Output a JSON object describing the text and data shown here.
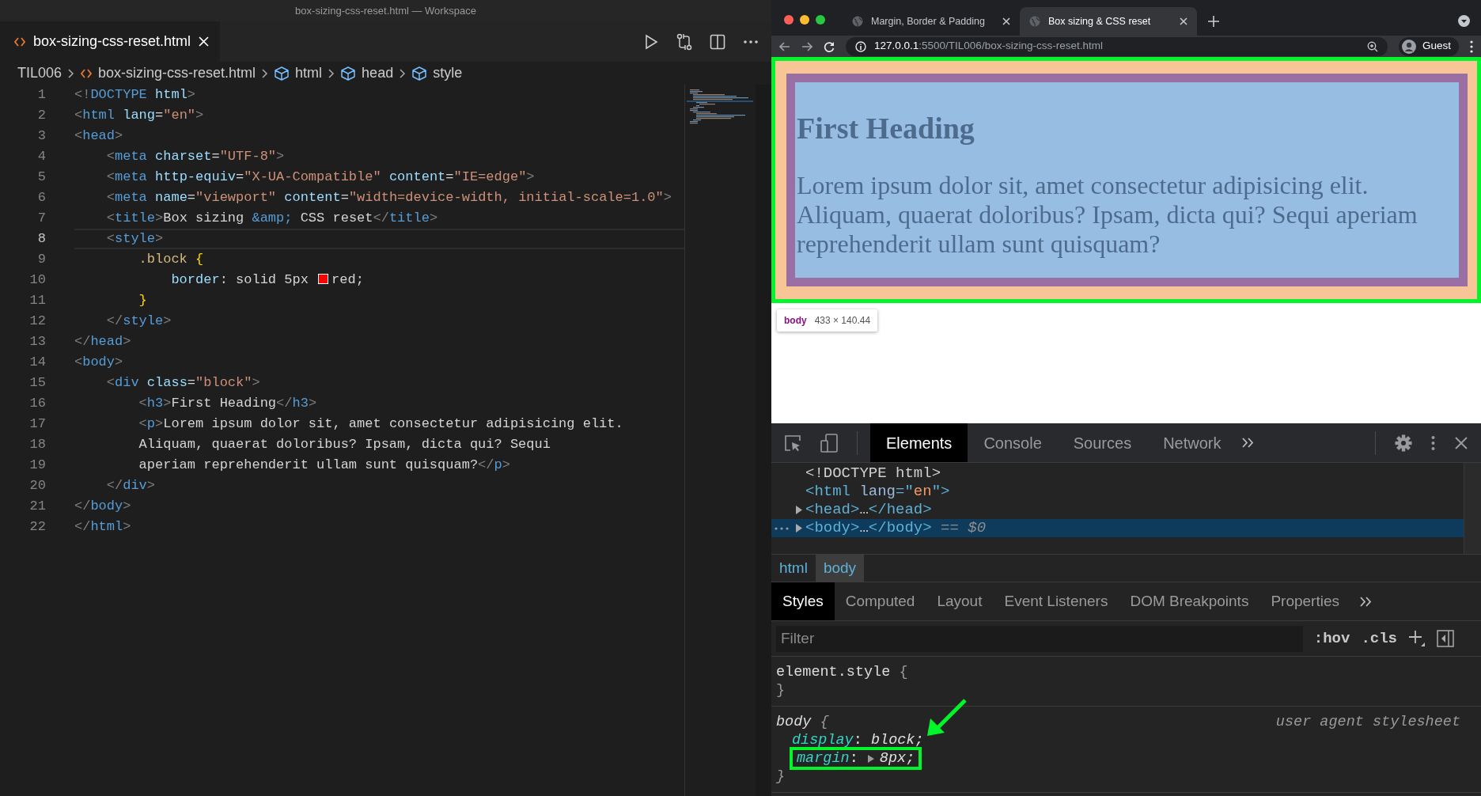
{
  "editor": {
    "window_title": "box-sizing-css-reset.html — Workspace",
    "tab": {
      "label": "box-sizing-css-reset.html"
    },
    "breadcrumbs": [
      {
        "kind": "folder",
        "label": "TIL006"
      },
      {
        "kind": "file",
        "label": "box-sizing-css-reset.html"
      },
      {
        "kind": "element",
        "label": "html"
      },
      {
        "kind": "element",
        "label": "head"
      },
      {
        "kind": "element",
        "label": "style"
      }
    ],
    "lines": [
      {
        "number": "1",
        "selected": false,
        "tokens": [
          {
            "kind": "p",
            "text": "<!"
          },
          {
            "kind": "tag",
            "text": "DOCTYPE"
          },
          {
            "kind": "attr",
            "text": " html"
          },
          {
            "kind": "p",
            "text": ">"
          }
        ]
      },
      {
        "number": "2",
        "selected": false,
        "tokens": [
          {
            "kind": "p",
            "text": "<"
          },
          {
            "kind": "tag",
            "text": "html"
          },
          {
            "kind": "attr",
            "text": " lang"
          },
          {
            "kind": "txt",
            "text": "="
          },
          {
            "kind": "str",
            "text": "\"en\""
          },
          {
            "kind": "p",
            "text": ">"
          }
        ]
      },
      {
        "number": "3",
        "selected": false,
        "tokens": [
          {
            "kind": "p",
            "text": "<"
          },
          {
            "kind": "tag",
            "text": "head"
          },
          {
            "kind": "p",
            "text": ">"
          }
        ]
      },
      {
        "number": "4",
        "selected": false,
        "tokens": [
          {
            "kind": "p",
            "text": "    <"
          },
          {
            "kind": "tag",
            "text": "meta"
          },
          {
            "kind": "attr",
            "text": " charset"
          },
          {
            "kind": "txt",
            "text": "="
          },
          {
            "kind": "str",
            "text": "\"UTF-8\""
          },
          {
            "kind": "p",
            "text": ">"
          }
        ]
      },
      {
        "number": "5",
        "selected": false,
        "tokens": [
          {
            "kind": "p",
            "text": "    <"
          },
          {
            "kind": "tag",
            "text": "meta"
          },
          {
            "kind": "attr",
            "text": " http-equiv"
          },
          {
            "kind": "txt",
            "text": "="
          },
          {
            "kind": "str",
            "text": "\"X-UA-Compatible\""
          },
          {
            "kind": "attr",
            "text": " content"
          },
          {
            "kind": "txt",
            "text": "="
          },
          {
            "kind": "str",
            "text": "\"IE=edge\""
          },
          {
            "kind": "p",
            "text": ">"
          }
        ]
      },
      {
        "number": "6",
        "selected": false,
        "tokens": [
          {
            "kind": "p",
            "text": "    <"
          },
          {
            "kind": "tag",
            "text": "meta"
          },
          {
            "kind": "attr",
            "text": " name"
          },
          {
            "kind": "txt",
            "text": "="
          },
          {
            "kind": "str",
            "text": "\"viewport\""
          },
          {
            "kind": "attr",
            "text": " content"
          },
          {
            "kind": "txt",
            "text": "="
          },
          {
            "kind": "str",
            "text": "\"width=device-width, initial-scale=1.0\""
          },
          {
            "kind": "p",
            "text": ">"
          }
        ]
      },
      {
        "number": "7",
        "selected": false,
        "tokens": [
          {
            "kind": "p",
            "text": "    <"
          },
          {
            "kind": "tag",
            "text": "title"
          },
          {
            "kind": "p",
            "text": ">"
          },
          {
            "kind": "txt",
            "text": "Box sizing "
          },
          {
            "kind": "ent",
            "text": "&amp;"
          },
          {
            "kind": "txt",
            "text": " CSS reset"
          },
          {
            "kind": "p",
            "text": "</"
          },
          {
            "kind": "tag",
            "text": "title"
          },
          {
            "kind": "p",
            "text": ">"
          }
        ]
      },
      {
        "number": "8",
        "selected": true,
        "tokens": [
          {
            "kind": "p",
            "text": "    <"
          },
          {
            "kind": "tag",
            "text": "style"
          },
          {
            "kind": "p",
            "text": ">"
          }
        ]
      },
      {
        "number": "9",
        "selected": false,
        "tokens": [
          {
            "kind": "sel",
            "text": "        .block"
          },
          {
            "kind": "brace",
            "text": " {"
          }
        ]
      },
      {
        "number": "10",
        "selected": false,
        "tokens": [
          {
            "kind": "prop",
            "text": "            border"
          },
          {
            "kind": "txt",
            "text": ": solid 5px "
          },
          {
            "kind": "swatch",
            "color": "#ff0000"
          },
          {
            "kind": "txt",
            "text": "red;"
          }
        ]
      },
      {
        "number": "11",
        "selected": false,
        "tokens": [
          {
            "kind": "brace",
            "text": "        }"
          }
        ]
      },
      {
        "number": "12",
        "selected": false,
        "tokens": [
          {
            "kind": "p",
            "text": "    </"
          },
          {
            "kind": "tag",
            "text": "style"
          },
          {
            "kind": "p",
            "text": ">"
          }
        ]
      },
      {
        "number": "13",
        "selected": false,
        "tokens": [
          {
            "kind": "p",
            "text": "</"
          },
          {
            "kind": "tag",
            "text": "head"
          },
          {
            "kind": "p",
            "text": ">"
          }
        ]
      },
      {
        "number": "14",
        "selected": false,
        "tokens": [
          {
            "kind": "p",
            "text": "<"
          },
          {
            "kind": "tag",
            "text": "body"
          },
          {
            "kind": "p",
            "text": ">"
          }
        ]
      },
      {
        "number": "15",
        "selected": false,
        "tokens": [
          {
            "kind": "p",
            "text": "    <"
          },
          {
            "kind": "tag",
            "text": "div"
          },
          {
            "kind": "attr",
            "text": " class"
          },
          {
            "kind": "txt",
            "text": "="
          },
          {
            "kind": "str",
            "text": "\"block\""
          },
          {
            "kind": "p",
            "text": ">"
          }
        ]
      },
      {
        "number": "16",
        "selected": false,
        "tokens": [
          {
            "kind": "p",
            "text": "        <"
          },
          {
            "kind": "tag",
            "text": "h3"
          },
          {
            "kind": "p",
            "text": ">"
          },
          {
            "kind": "txt",
            "text": "First Heading"
          },
          {
            "kind": "p",
            "text": "</"
          },
          {
            "kind": "tag",
            "text": "h3"
          },
          {
            "kind": "p",
            "text": ">"
          }
        ]
      },
      {
        "number": "17",
        "selected": false,
        "tokens": [
          {
            "kind": "p",
            "text": "        <"
          },
          {
            "kind": "tag",
            "text": "p"
          },
          {
            "kind": "p",
            "text": ">"
          },
          {
            "kind": "txt",
            "text": "Lorem ipsum dolor sit, amet consectetur adipisicing elit."
          }
        ]
      },
      {
        "number": "18",
        "selected": false,
        "tokens": [
          {
            "kind": "txt",
            "text": "        Aliquam, quaerat doloribus? Ipsam, dicta qui? Sequi"
          }
        ]
      },
      {
        "number": "19",
        "selected": false,
        "tokens": [
          {
            "kind": "txt",
            "text": "        aperiam reprehenderit ullam sunt quisquam?"
          },
          {
            "kind": "p",
            "text": "</"
          },
          {
            "kind": "tag",
            "text": "p"
          },
          {
            "kind": "p",
            "text": ">"
          }
        ]
      },
      {
        "number": "20",
        "selected": false,
        "tokens": [
          {
            "kind": "p",
            "text": "    </"
          },
          {
            "kind": "tag",
            "text": "div"
          },
          {
            "kind": "p",
            "text": ">"
          }
        ]
      },
      {
        "number": "21",
        "selected": false,
        "tokens": [
          {
            "kind": "p",
            "text": "</"
          },
          {
            "kind": "tag",
            "text": "body"
          },
          {
            "kind": "p",
            "text": ">"
          }
        ]
      },
      {
        "number": "22",
        "selected": false,
        "tokens": [
          {
            "kind": "p",
            "text": "</"
          },
          {
            "kind": "tag",
            "text": "html"
          },
          {
            "kind": "p",
            "text": ">"
          }
        ]
      }
    ]
  },
  "browser": {
    "tabs": [
      {
        "label": "Margin, Border & Padding",
        "selected": false
      },
      {
        "label": "Box sizing & CSS reset",
        "selected": true
      }
    ],
    "url": {
      "host": "127.0.0.1",
      "rest": ":5500/TIL006/box-sizing-css-reset.html"
    },
    "profile": "Guest",
    "page": {
      "framed": true,
      "heading": "First Heading",
      "paragraph": "Lorem ipsum dolor sit, amet consectetur adipisicing elit. Aliquam, quaerat doloribus? Ipsam, dicta qui? Sequi aperiam reprehenderit ullam sunt quisquam?",
      "tooltip": {
        "tag": "body",
        "size": "433 × 140.44"
      }
    },
    "devtools": {
      "tabs": [
        {
          "label": "Elements",
          "selected": true
        },
        {
          "label": "Console",
          "selected": false
        },
        {
          "label": "Sources",
          "selected": false
        },
        {
          "label": "Network",
          "selected": false
        }
      ],
      "dom": [
        {
          "selected": false,
          "tokens": [
            {
              "kind": "plain",
              "text": "<!DOCTYPE html>"
            }
          ]
        },
        {
          "selected": false,
          "tokens": [
            {
              "kind": "tag",
              "text": "<html"
            },
            {
              "kind": "attr",
              "text": " lang"
            },
            {
              "kind": "tag",
              "text": "=\""
            },
            {
              "kind": "str",
              "text": "en"
            },
            {
              "kind": "tag",
              "text": "\">"
            }
          ]
        },
        {
          "expanded": false,
          "selected": false,
          "tokens": [
            {
              "kind": "tag",
              "text": "<head>"
            },
            {
              "kind": "plain",
              "text": "…"
            },
            {
              "kind": "tag",
              "text": "</head>"
            }
          ]
        },
        {
          "expanded": false,
          "selected": true,
          "tokens": [
            {
              "kind": "tag",
              "text": "<body>"
            },
            {
              "kind": "plain",
              "text": "…"
            },
            {
              "kind": "tag",
              "text": "</body>"
            },
            {
              "kind": "ref",
              "text": " == $0"
            }
          ]
        }
      ],
      "crumbs": [
        {
          "label": "html",
          "selected": false
        },
        {
          "label": "body",
          "selected": true
        }
      ],
      "pane_tabs": [
        {
          "label": "Styles",
          "selected": true
        },
        {
          "label": "Computed",
          "selected": false
        },
        {
          "label": "Layout",
          "selected": false
        },
        {
          "label": "Event Listeners",
          "selected": false
        },
        {
          "label": "DOM Breakpoints",
          "selected": false
        },
        {
          "label": "Properties",
          "selected": false
        }
      ],
      "filter": {
        "placeholder": "Filter"
      },
      "hov": ":hov",
      "cls": ".cls",
      "rules": [
        {
          "selector": "element.style",
          "italic": false,
          "open": "{",
          "close": "}"
        },
        {
          "selector": "body",
          "italic": true,
          "open": "{",
          "close": "}",
          "source": "user agent stylesheet",
          "declarations": [
            {
              "property": "display",
              "colon": ":",
              "value": "block;",
              "expandable": false,
              "framed": false,
              "arrow": true
            },
            {
              "property": "margin",
              "colon": ":",
              "value": "8px;",
              "expandable": true,
              "framed": true,
              "arrow": false
            }
          ]
        }
      ]
    }
  }
}
